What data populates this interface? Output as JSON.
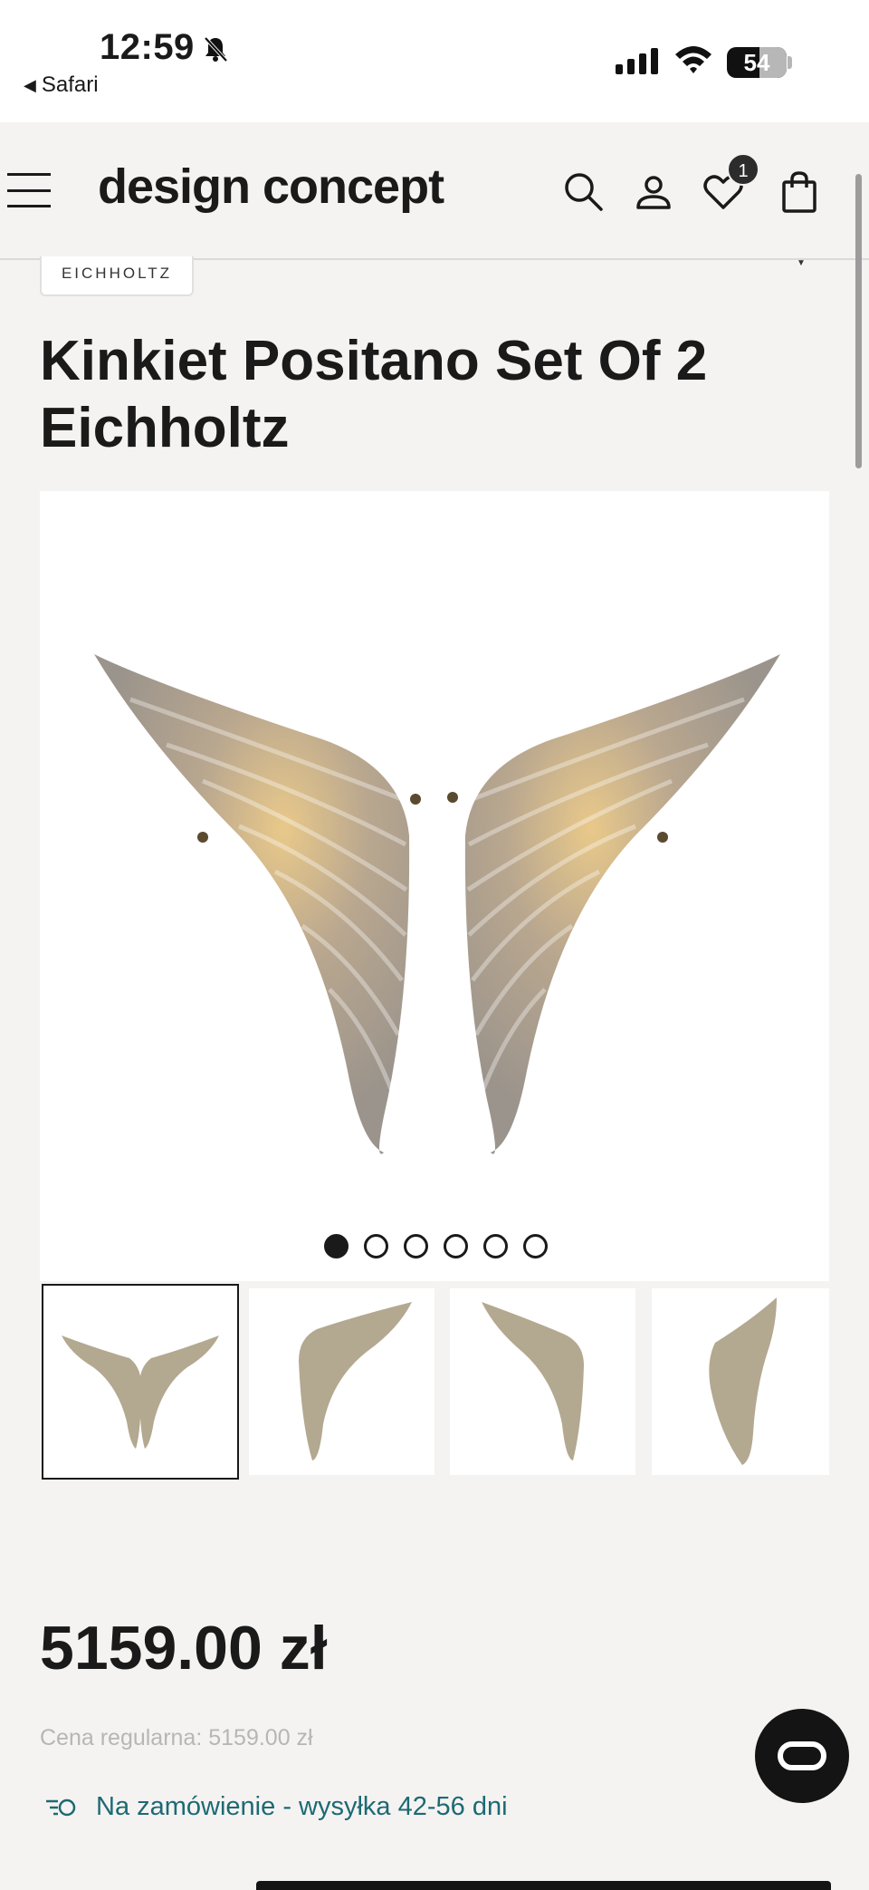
{
  "status_bar": {
    "time": "12:59",
    "back_app": "Safari",
    "battery": "54",
    "icons": [
      "bell-slash-icon",
      "cellular-signal-icon",
      "wifi-icon",
      "battery-icon"
    ]
  },
  "header": {
    "logo": "design concept",
    "wishlist_count": "1",
    "icons": [
      "menu-icon",
      "search-icon",
      "account-icon",
      "heart-icon",
      "shopping-bag-icon"
    ]
  },
  "product": {
    "brand": "EICHHOLTZ",
    "title": "Kinkiet Positano Set Of 2 Eichholtz",
    "image_count": 6,
    "active_image": 1,
    "thumbnails": [
      "pair of sconces",
      "single sconce front",
      "single sconce angled",
      "single sconce side"
    ],
    "price": "5159.00 zł",
    "regular_price": "Cena regularna: 5159.00 zł",
    "availability": "Na zamówienie - wysyłka 42-56 dni"
  },
  "colors": {
    "background": "#f5f3f1",
    "availability_text": "#1c6a74",
    "dark": "#141414"
  }
}
